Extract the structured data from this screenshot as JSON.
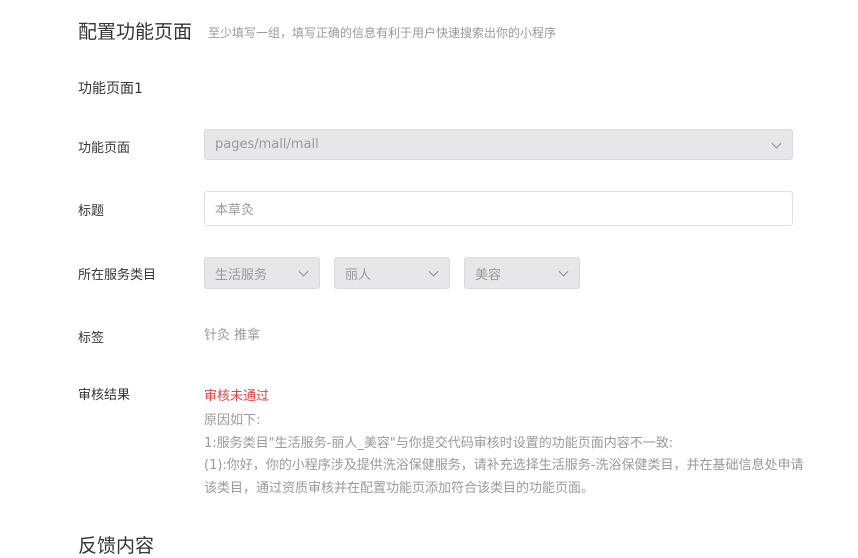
{
  "section_title": "配置功能页面",
  "section_hint": "至少填写一组，填写正确的信息有利于用户快速搜索出你的小程序",
  "group_title": "功能页面1",
  "fields": {
    "page": {
      "label": "功能页面",
      "value": "pages/mall/mall"
    },
    "title": {
      "label": "标题",
      "value": "本草灸"
    },
    "category": {
      "label": "所在服务类目",
      "values": [
        "生活服务",
        "丽人",
        "美容"
      ]
    },
    "tags": {
      "label": "标签",
      "value": "针灸 推拿"
    },
    "review": {
      "label": "审核结果",
      "status": "审核未通过",
      "status_color": "#e64340",
      "reason_lines": [
        "原因如下:",
        "1:服务类目\"生活服务-丽人_美容\"与你提交代码审核时设置的功能页面内容不一致:",
        "(1):你好，你的小程序涉及提供洗浴保健服务，请补充选择生活服务-洗浴保健类目，并在基础信息处申请该类目，通过资质审核并在配置功能页添加符合该类目的功能页面。"
      ]
    }
  },
  "next_section_title": "反馈内容"
}
